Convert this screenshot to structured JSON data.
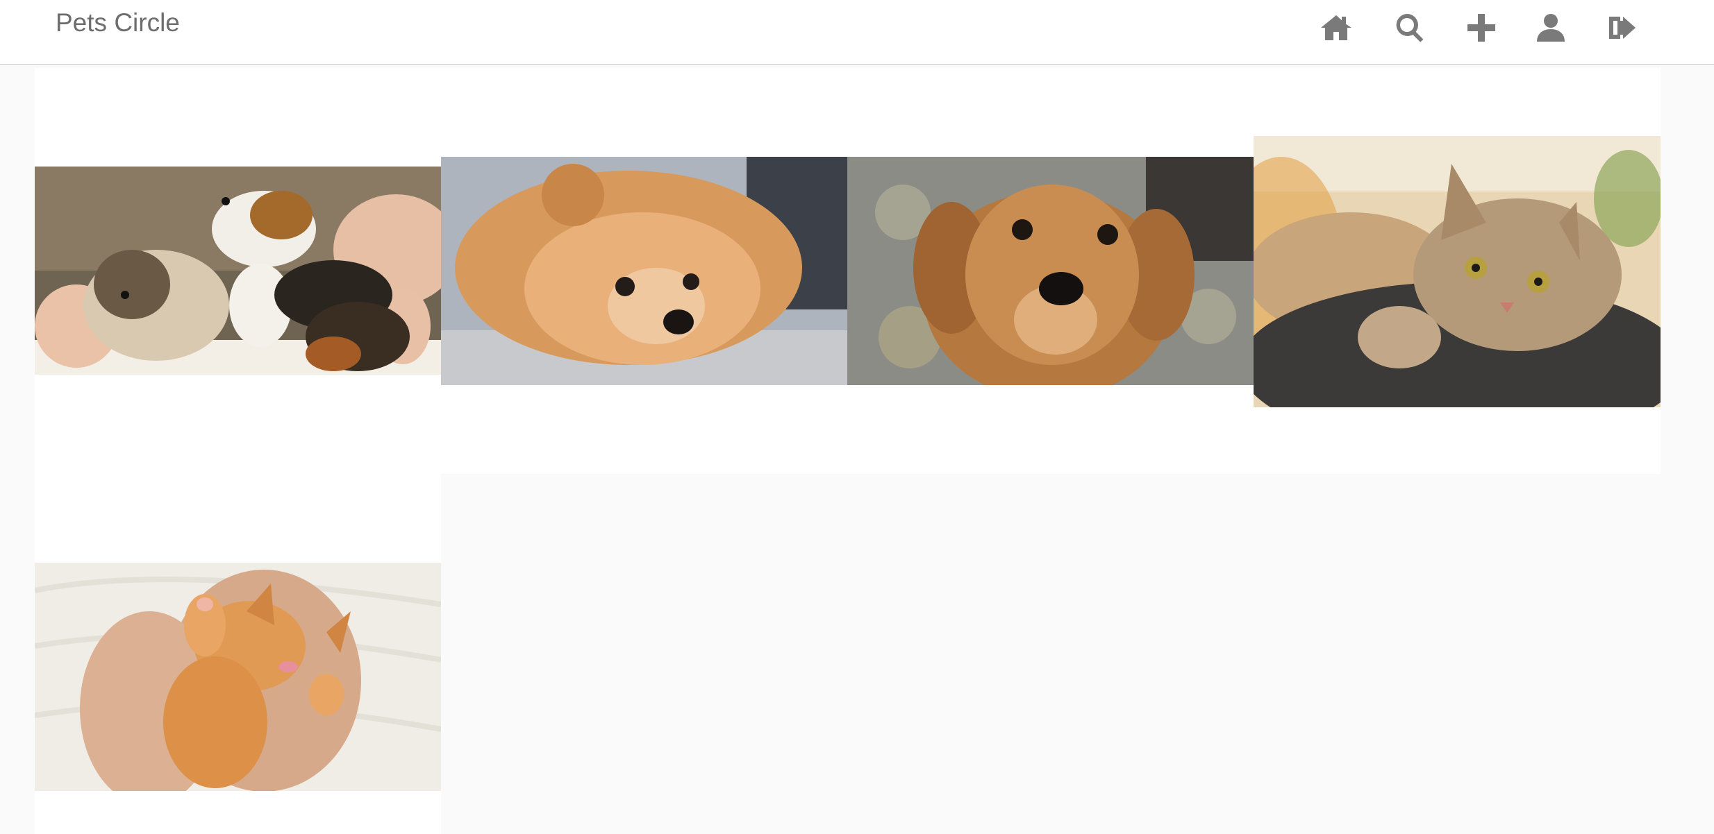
{
  "navbar": {
    "brand": "Pets Circle",
    "icons": [
      "home-icon",
      "search-icon",
      "plus-icon",
      "user-icon",
      "sign-out-icon"
    ]
  },
  "feed": {
    "posts": [
      {
        "subject": "guinea-pigs",
        "colors": {
          "bg": "#8a7a63",
          "fur": "#d9c9b1",
          "dark": "#2b2520"
        }
      },
      {
        "subject": "pomeranian",
        "colors": {
          "bg": "#aeb4bd",
          "fur": "#d79a5c",
          "dark": "#241c18"
        }
      },
      {
        "subject": "golden-puppy",
        "colors": {
          "bg": "#8b8c86",
          "fur": "#c98d52",
          "dark": "#1e1611"
        }
      },
      {
        "subject": "tabby-cat",
        "colors": {
          "bg": "#e8d6b4",
          "fur": "#b59a7a",
          "dark": "#3c3a39"
        }
      },
      {
        "subject": "orange-kitten",
        "colors": {
          "bg": "#efede6",
          "fur": "#e19a54",
          "dark": "#d7a98b"
        }
      }
    ]
  }
}
